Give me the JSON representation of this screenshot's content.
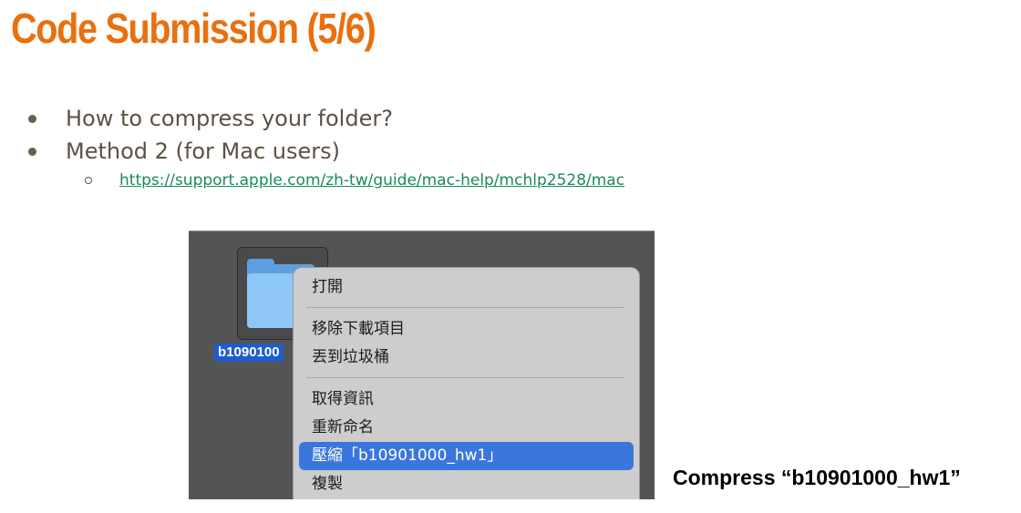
{
  "title": "Code Submission (5/6)",
  "bullets": [
    "How to compress your folder?",
    "Method 2 (for Mac users)"
  ],
  "link": "https://support.apple.com/zh-tw/guide/mac-help/mchlp2528/mac",
  "screenshot": {
    "folder_label": "b1090100",
    "menu_items": [
      "打開",
      "移除下載項目",
      "丟到垃圾桶",
      "取得資訊",
      "重新命名",
      "壓縮「b10901000_hw1」",
      "複製"
    ],
    "selected_item": "壓縮「b10901000_hw1」"
  },
  "caption": "Compress “b10901000_hw1”",
  "colors": {
    "title": "#e8700f",
    "link": "#1a8a5a",
    "menu_selected": "#3b76dc",
    "file_label_bg": "#1f5ccc"
  }
}
